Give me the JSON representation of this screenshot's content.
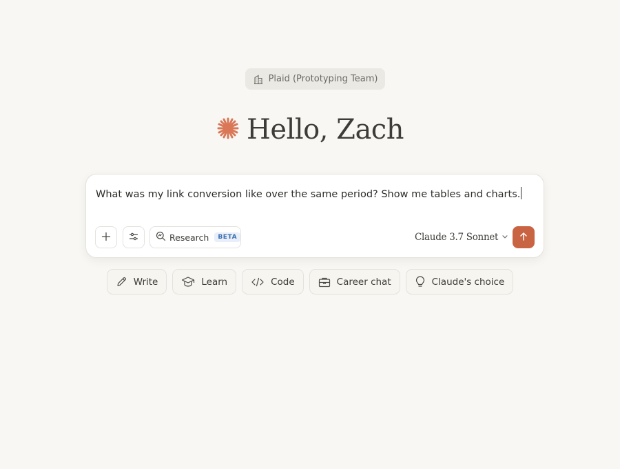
{
  "org": {
    "label": "Plaid (Prototyping Team)",
    "icon": "building-icon"
  },
  "greeting": {
    "text": "Hello, Zach",
    "icon": "claude-spark-icon",
    "icon_color": "#d97757"
  },
  "composer": {
    "input_value": "What was my link conversion like over the same period? Show me tables and charts.",
    "add_icon": "plus-icon",
    "tools_icon": "sliders-icon",
    "research": {
      "label": "Research",
      "badge": "BETA",
      "icon": "search-zoom-icon"
    },
    "model": {
      "label": "Claude 3.7 Sonnet",
      "icon": "chevron-down-icon"
    },
    "send": {
      "icon": "arrow-up-icon",
      "color": "#c96442"
    }
  },
  "chips": [
    {
      "label": "Write",
      "icon": "pencil-icon"
    },
    {
      "label": "Learn",
      "icon": "graduation-cap-icon"
    },
    {
      "label": "Code",
      "icon": "code-icon"
    },
    {
      "label": "Career chat",
      "icon": "briefcase-icon"
    },
    {
      "label": "Claude's choice",
      "icon": "lightbulb-icon"
    }
  ]
}
